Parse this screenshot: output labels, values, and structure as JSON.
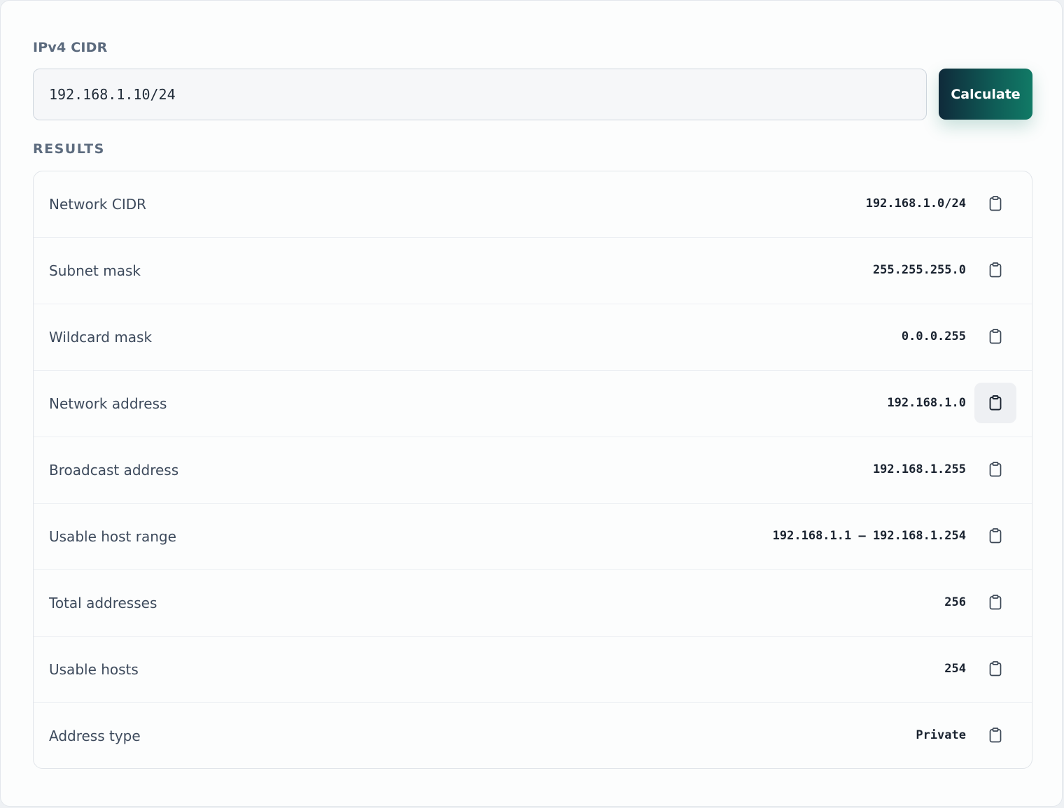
{
  "input": {
    "label": "IPv4 CIDR",
    "value": "192.168.1.10/24",
    "button_label": "Calculate"
  },
  "results": {
    "heading": "RESULTS",
    "rows": [
      {
        "label": "Network CIDR",
        "value": "192.168.1.0/24"
      },
      {
        "label": "Subnet mask",
        "value": "255.255.255.0"
      },
      {
        "label": "Wildcard mask",
        "value": "0.0.0.255"
      },
      {
        "label": "Network address",
        "value": "192.168.1.0"
      },
      {
        "label": "Broadcast address",
        "value": "192.168.1.255"
      },
      {
        "label": "Usable host range",
        "value": "192.168.1.1 – 192.168.1.254"
      },
      {
        "label": "Total addresses",
        "value": "256"
      },
      {
        "label": "Usable hosts",
        "value": "254"
      },
      {
        "label": "Address type",
        "value": "Private"
      }
    ],
    "copy_icon": "clipboard-icon",
    "hovered_copy_row": 3
  },
  "colors": {
    "accent_start": "#0f2a3a",
    "accent_end": "#117a66"
  }
}
